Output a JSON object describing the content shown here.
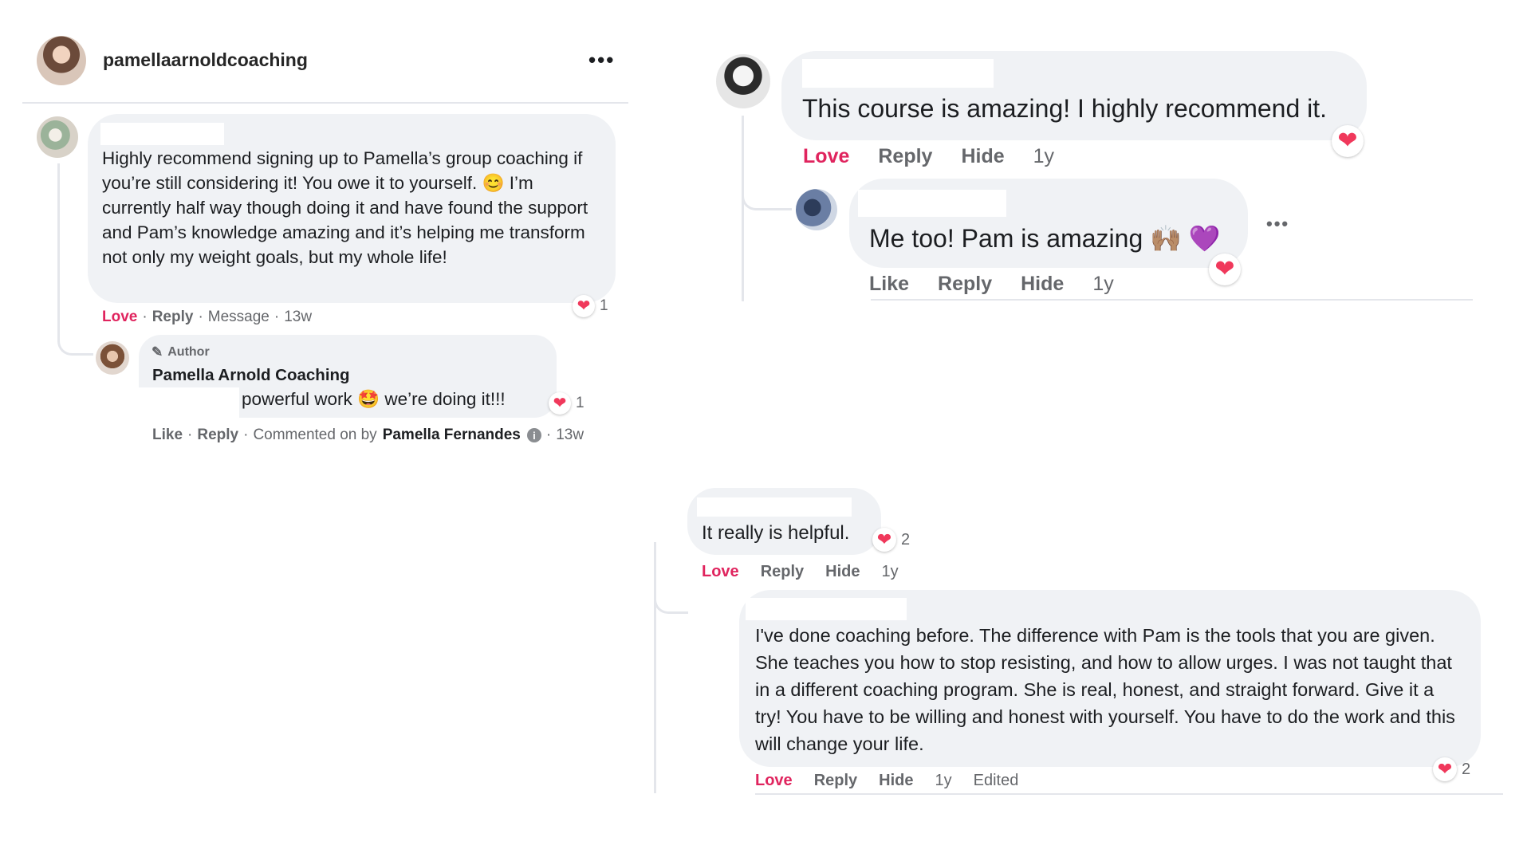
{
  "colors": {
    "love": "#e0245e",
    "heart": "#f0385b",
    "bubble": "#f0f2f5",
    "muted": "#65676b"
  },
  "post": {
    "username": "pamellaarnoldcoaching",
    "more_icon": "more-horizontal-icon"
  },
  "left_comment": {
    "text": "Highly recommend signing up to Pamella’s group coaching if you’re still considering it! You owe it to yourself. 😊 I’m currently half way though doing it and have found the support and Pam’s knowledge amazing and it’s helping me transform not only my weight goals, but my whole life!",
    "actions": {
      "love": "Love",
      "reply": "Reply",
      "message": "Message",
      "time": "13w"
    },
    "reaction_count": "1"
  },
  "left_reply": {
    "badge": "Author",
    "name": "Pamella Arnold Coaching",
    "text": "powerful work 🤩 we’re doing it!!!",
    "reaction_count": "1",
    "actions": {
      "like": "Like",
      "reply": "Reply",
      "commented_on_by": "Commented on by",
      "commenter": "Pamella Fernandes",
      "time": "13w"
    }
  },
  "right_top": {
    "comment": {
      "text": "This course is amazing! I highly recommend it.",
      "actions": {
        "love": "Love",
        "reply": "Reply",
        "hide": "Hide",
        "time": "1y"
      }
    },
    "reply": {
      "text": "Me too! Pam is amazing 🙌🏽 💜",
      "actions": {
        "like": "Like",
        "reply": "Reply",
        "hide": "Hide",
        "time": "1y"
      }
    }
  },
  "right_bottom": {
    "comment": {
      "text": "It really is helpful.",
      "reaction_count": "2",
      "actions": {
        "love": "Love",
        "reply": "Reply",
        "hide": "Hide",
        "time": "1y"
      }
    },
    "reply": {
      "text": "I've done coaching before. The difference with Pam is the tools that you are given. She teaches you how to stop resisting, and how to allow urges. I was not taught that in a different coaching program. She is real, honest, and straight forward. Give it a try! You have to be willing and honest with yourself. You have to do the work and this will change your life.",
      "reaction_count": "2",
      "actions": {
        "love": "Love",
        "reply": "Reply",
        "hide": "Hide",
        "time": "1y",
        "edited": "Edited"
      }
    }
  }
}
